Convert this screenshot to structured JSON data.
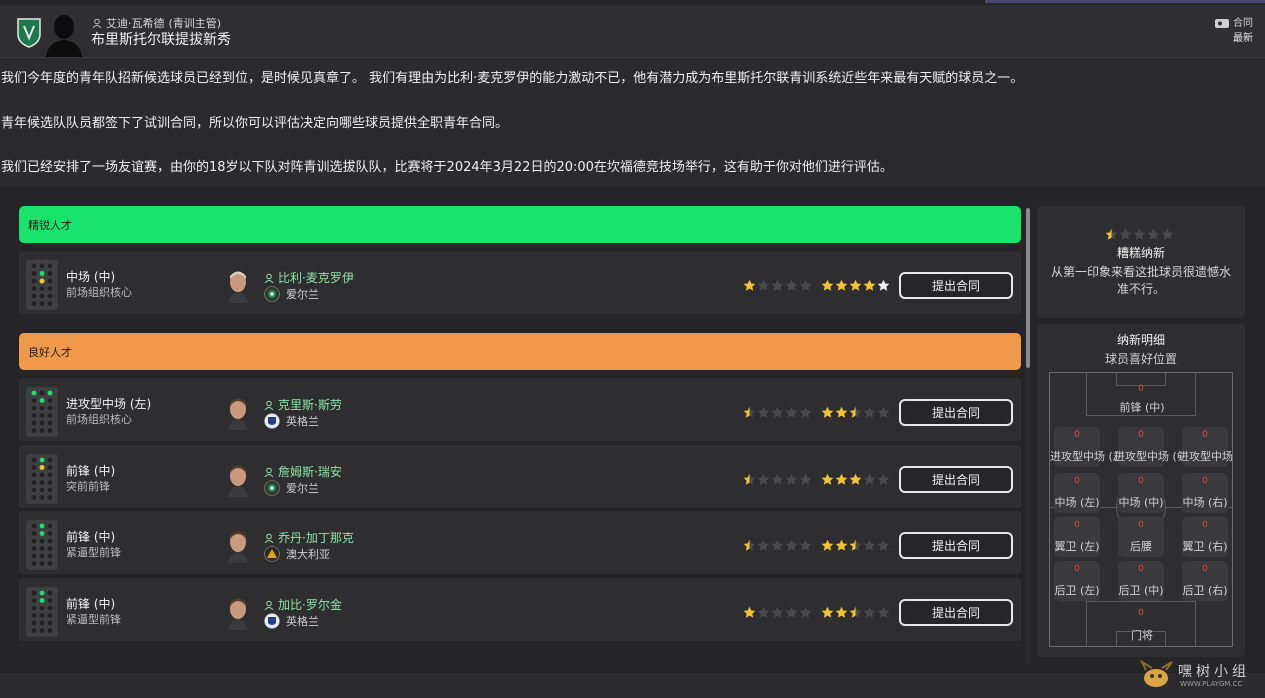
{
  "header": {
    "sender": "艾迪·瓦希德",
    "sender_role": "(青训主管)",
    "subject": "布里斯托尔联提拔新秀",
    "merge_label": "合同",
    "latest_label": "最新"
  },
  "message": {
    "p1": "我们今年度的青年队招新候选球员已经到位，是时候见真章了。 我们有理由为比利·麦克罗伊的能力激动不已，他有潜力成为布里斯托尔联青训系统近些年来最有天赋的球员之一。",
    "p2": "青年候选队队员都签下了试训合同，所以你可以评估决定向哪些球员提供全职青年合同。",
    "p3": "我们已经安排了一场友谊赛，由你的18岁以下队对阵青训选拔队队，比赛将于2024年3月22日的20:00在坎福德竞技场举行，这有助于你对他们进行评估。"
  },
  "categories": {
    "excellent": "精锐人才",
    "good": "良好人才"
  },
  "offer_label": "提出合同",
  "players": [
    {
      "position": "中场 (中)",
      "role": "前场组织核心",
      "name": "比利·麦克罗伊",
      "nation": "爱尔兰",
      "current_stars": 1,
      "potential_stars": 5,
      "category": "excellent"
    },
    {
      "position": "进攻型中场 (左)",
      "role": "前场组织核心",
      "name": "克里斯·斯劳",
      "nation": "英格兰",
      "current_stars": 0.5,
      "potential_stars": 2.5,
      "category": "good"
    },
    {
      "position": "前锋 (中)",
      "role": "突前前锋",
      "name": "詹姆斯·瑞安",
      "nation": "爱尔兰",
      "current_stars": 0.5,
      "potential_stars": 3,
      "category": "good"
    },
    {
      "position": "前锋 (中)",
      "role": "紧逼型前锋",
      "name": "乔丹·加丁那克",
      "nation": "澳大利亚",
      "current_stars": 0.5,
      "potential_stars": 2.5,
      "category": "good"
    },
    {
      "position": "前锋 (中)",
      "role": "紧逼型前锋",
      "name": "加比·罗尔金",
      "nation": "英格兰",
      "current_stars": 1,
      "potential_stars": 2.5,
      "category": "good"
    }
  ],
  "summary": {
    "stars": 0.5,
    "title": "糟糕纳新",
    "desc": "从第一印象来看这批球员很遗憾水准不行。"
  },
  "details": {
    "title": "纳新明细",
    "subtitle": "球员喜好位置",
    "slots": {
      "st": {
        "label": "前锋 (中)",
        "count": "0"
      },
      "aml": {
        "label": "进攻型中场 (左)",
        "count": "0"
      },
      "amc": {
        "label": "进攻型中场 (中)",
        "count": "0"
      },
      "amr": {
        "label": "进攻型中场 (右)",
        "count": "0"
      },
      "ml": {
        "label": "中场 (左)",
        "count": "0"
      },
      "mc": {
        "label": "中场 (中)",
        "count": "0"
      },
      "mr": {
        "label": "中场 (右)",
        "count": "0"
      },
      "wbl": {
        "label": "翼卫 (左)",
        "count": "0"
      },
      "dm": {
        "label": "后腰",
        "count": "0"
      },
      "wbr": {
        "label": "翼卫 (右)",
        "count": "0"
      },
      "dl": {
        "label": "后卫 (左)",
        "count": "0"
      },
      "dc": {
        "label": "后卫 (中)",
        "count": "0"
      },
      "dr": {
        "label": "后卫 (右)",
        "count": "0"
      },
      "gk": {
        "label": "门将",
        "count": "0"
      }
    }
  },
  "watermark": {
    "text": "嘿树小组",
    "url": "WWW.PLAYGM.CC"
  },
  "colors": {
    "excellent_bar": "#19e36c",
    "good_bar": "#f0994a",
    "star": "#f2c430",
    "name": "#8fe3a6"
  },
  "icons": {
    "crest": "club-crest-icon",
    "person": "person-icon",
    "merge": "merge-icon",
    "star": "star-icon"
  }
}
